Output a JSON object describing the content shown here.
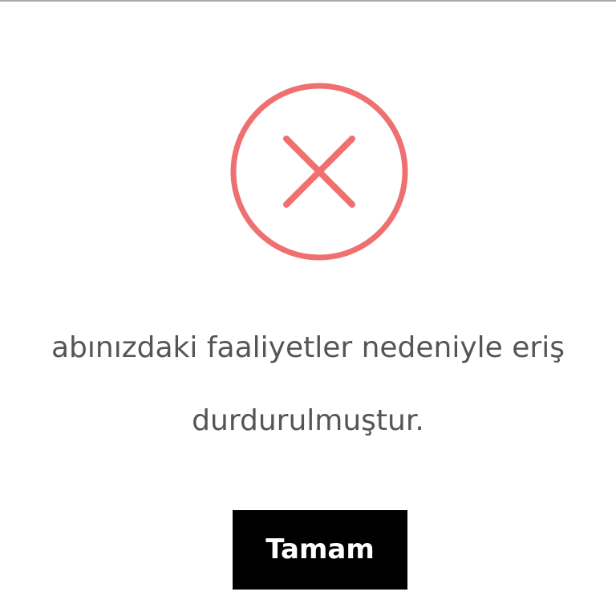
{
  "dialog": {
    "icon": "close-icon",
    "accent_color": "#ef7070",
    "message_line1": "abınızdaki faaliyetler nedeniyle eriş",
    "message_line2": "durdurulmuştur.",
    "ok_label": "Tamam"
  }
}
